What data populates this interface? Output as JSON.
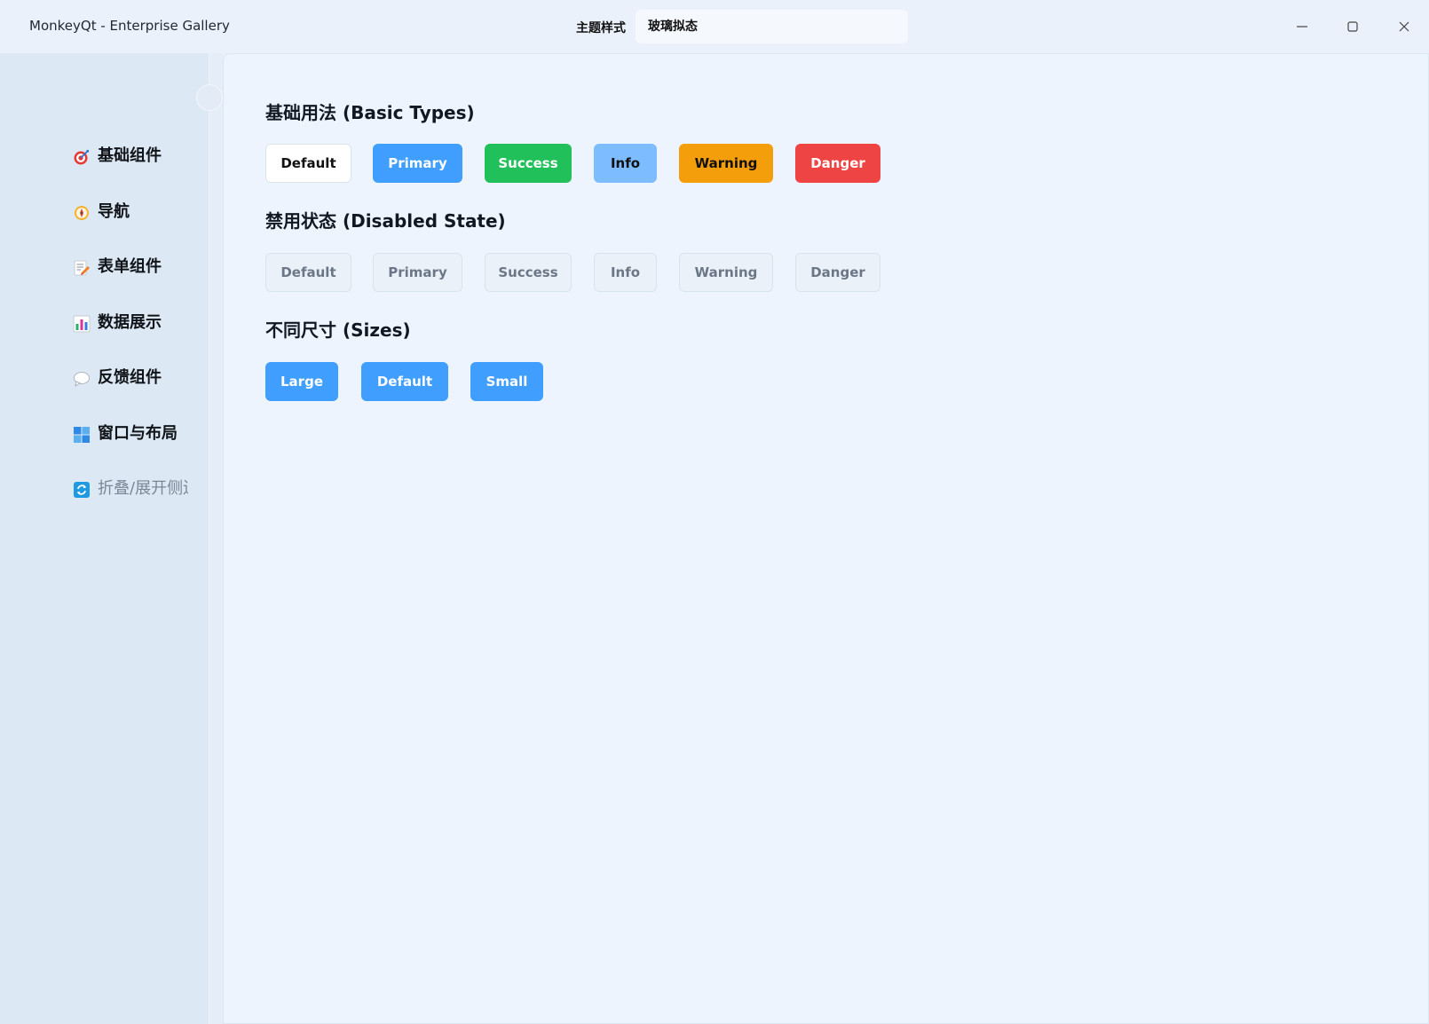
{
  "titlebar": {
    "app_title": "MonkeyQt - Enterprise Gallery",
    "theme_label": "主题样式",
    "theme_value": "玻璃拟态"
  },
  "sidebar": {
    "items": [
      {
        "label": "基础组件",
        "icon": "target-icon"
      },
      {
        "label": "导航",
        "icon": "compass-icon"
      },
      {
        "label": "表单组件",
        "icon": "memo-icon"
      },
      {
        "label": "数据展示",
        "icon": "bar-chart-icon"
      },
      {
        "label": "反馈组件",
        "icon": "speech-bubble-icon"
      },
      {
        "label": "窗口与布局",
        "icon": "window-icon"
      },
      {
        "label": "折叠/展开侧边栏",
        "icon": "refresh-icon"
      }
    ]
  },
  "sections": {
    "basic": {
      "title": "基础用法 (Basic Types)",
      "buttons": [
        "Default",
        "Primary",
        "Success",
        "Info",
        "Warning",
        "Danger"
      ]
    },
    "disabled": {
      "title": "禁用状态 (Disabled State)",
      "buttons": [
        "Default",
        "Primary",
        "Success",
        "Info",
        "Warning",
        "Danger"
      ]
    },
    "sizes": {
      "title": "不同尺寸 (Sizes)",
      "buttons": [
        "Large",
        "Default",
        "Small"
      ]
    }
  },
  "colors": {
    "primary": "#409eff",
    "success": "#22c05a",
    "info": "#7cbcff",
    "warning": "#f59e0b",
    "danger": "#ef4444"
  }
}
